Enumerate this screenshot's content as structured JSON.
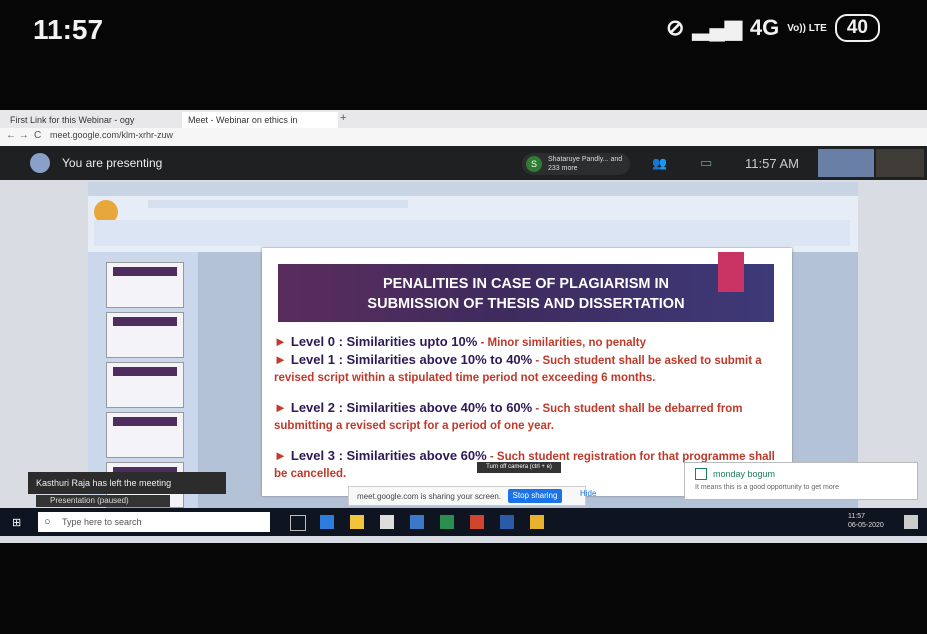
{
  "phone_status": {
    "time": "11:57",
    "signal_text": "4G",
    "volte_text": "Vo)) LTE",
    "battery": "40"
  },
  "browser": {
    "tabs": [
      "First Link for this Webinar - ogy",
      "Meet - Webinar on ethics in"
    ],
    "url": "meet.google.com/klm-xrhr-zuw"
  },
  "meet": {
    "presenting_label": "You are presenting",
    "participants_initial": "S",
    "participants_text": "Shataruye Pandly... and 233 more",
    "time": "11:57 AM"
  },
  "slide": {
    "title_line1": "PENALITIES IN CASE OF PLAGIARISM IN",
    "title_line2": "SUBMISSION OF THESIS AND DISSERTATION",
    "bullets": [
      {
        "level": "Level 0 : Similarities upto 10%",
        "desc": " - Minor similarities, no penalty"
      },
      {
        "level": "Level 1 : Similarities above 10% to 40%",
        "desc": " - Such student shall be asked to submit a revised script within a stipulated time period not exceeding 6 months."
      },
      {
        "level": "Level 2 : Similarities above 40% to 60%",
        "desc": " - Such student shall be debarred from submitting a revised script for a period of one year."
      },
      {
        "level": "Level 3 : Similarities above 60%",
        "desc": " - Such student registration for that programme shall be cancelled."
      }
    ]
  },
  "overlays": {
    "left_notice": "Kasthuri Raja has left the meeting",
    "presentation_label": "Presentation (paused)",
    "share_text": "meet.google.com is sharing your screen.",
    "stop_sharing": "Stop sharing",
    "hide": "Hide",
    "tooltip": "Turn off camera (ctrl + e)",
    "notif_title": "monday bogum",
    "notif_body": "It means this is a good opportunity to get more"
  },
  "taskbar": {
    "search_placeholder": "Type here to search",
    "tray_time": "11:57",
    "tray_date": "06-05-2020"
  },
  "colors": {
    "slide_title_bg": "#4a2b60",
    "accent": "#c93464",
    "bullet_text": "#8a1616",
    "bullet_desc": "#c0392b"
  }
}
